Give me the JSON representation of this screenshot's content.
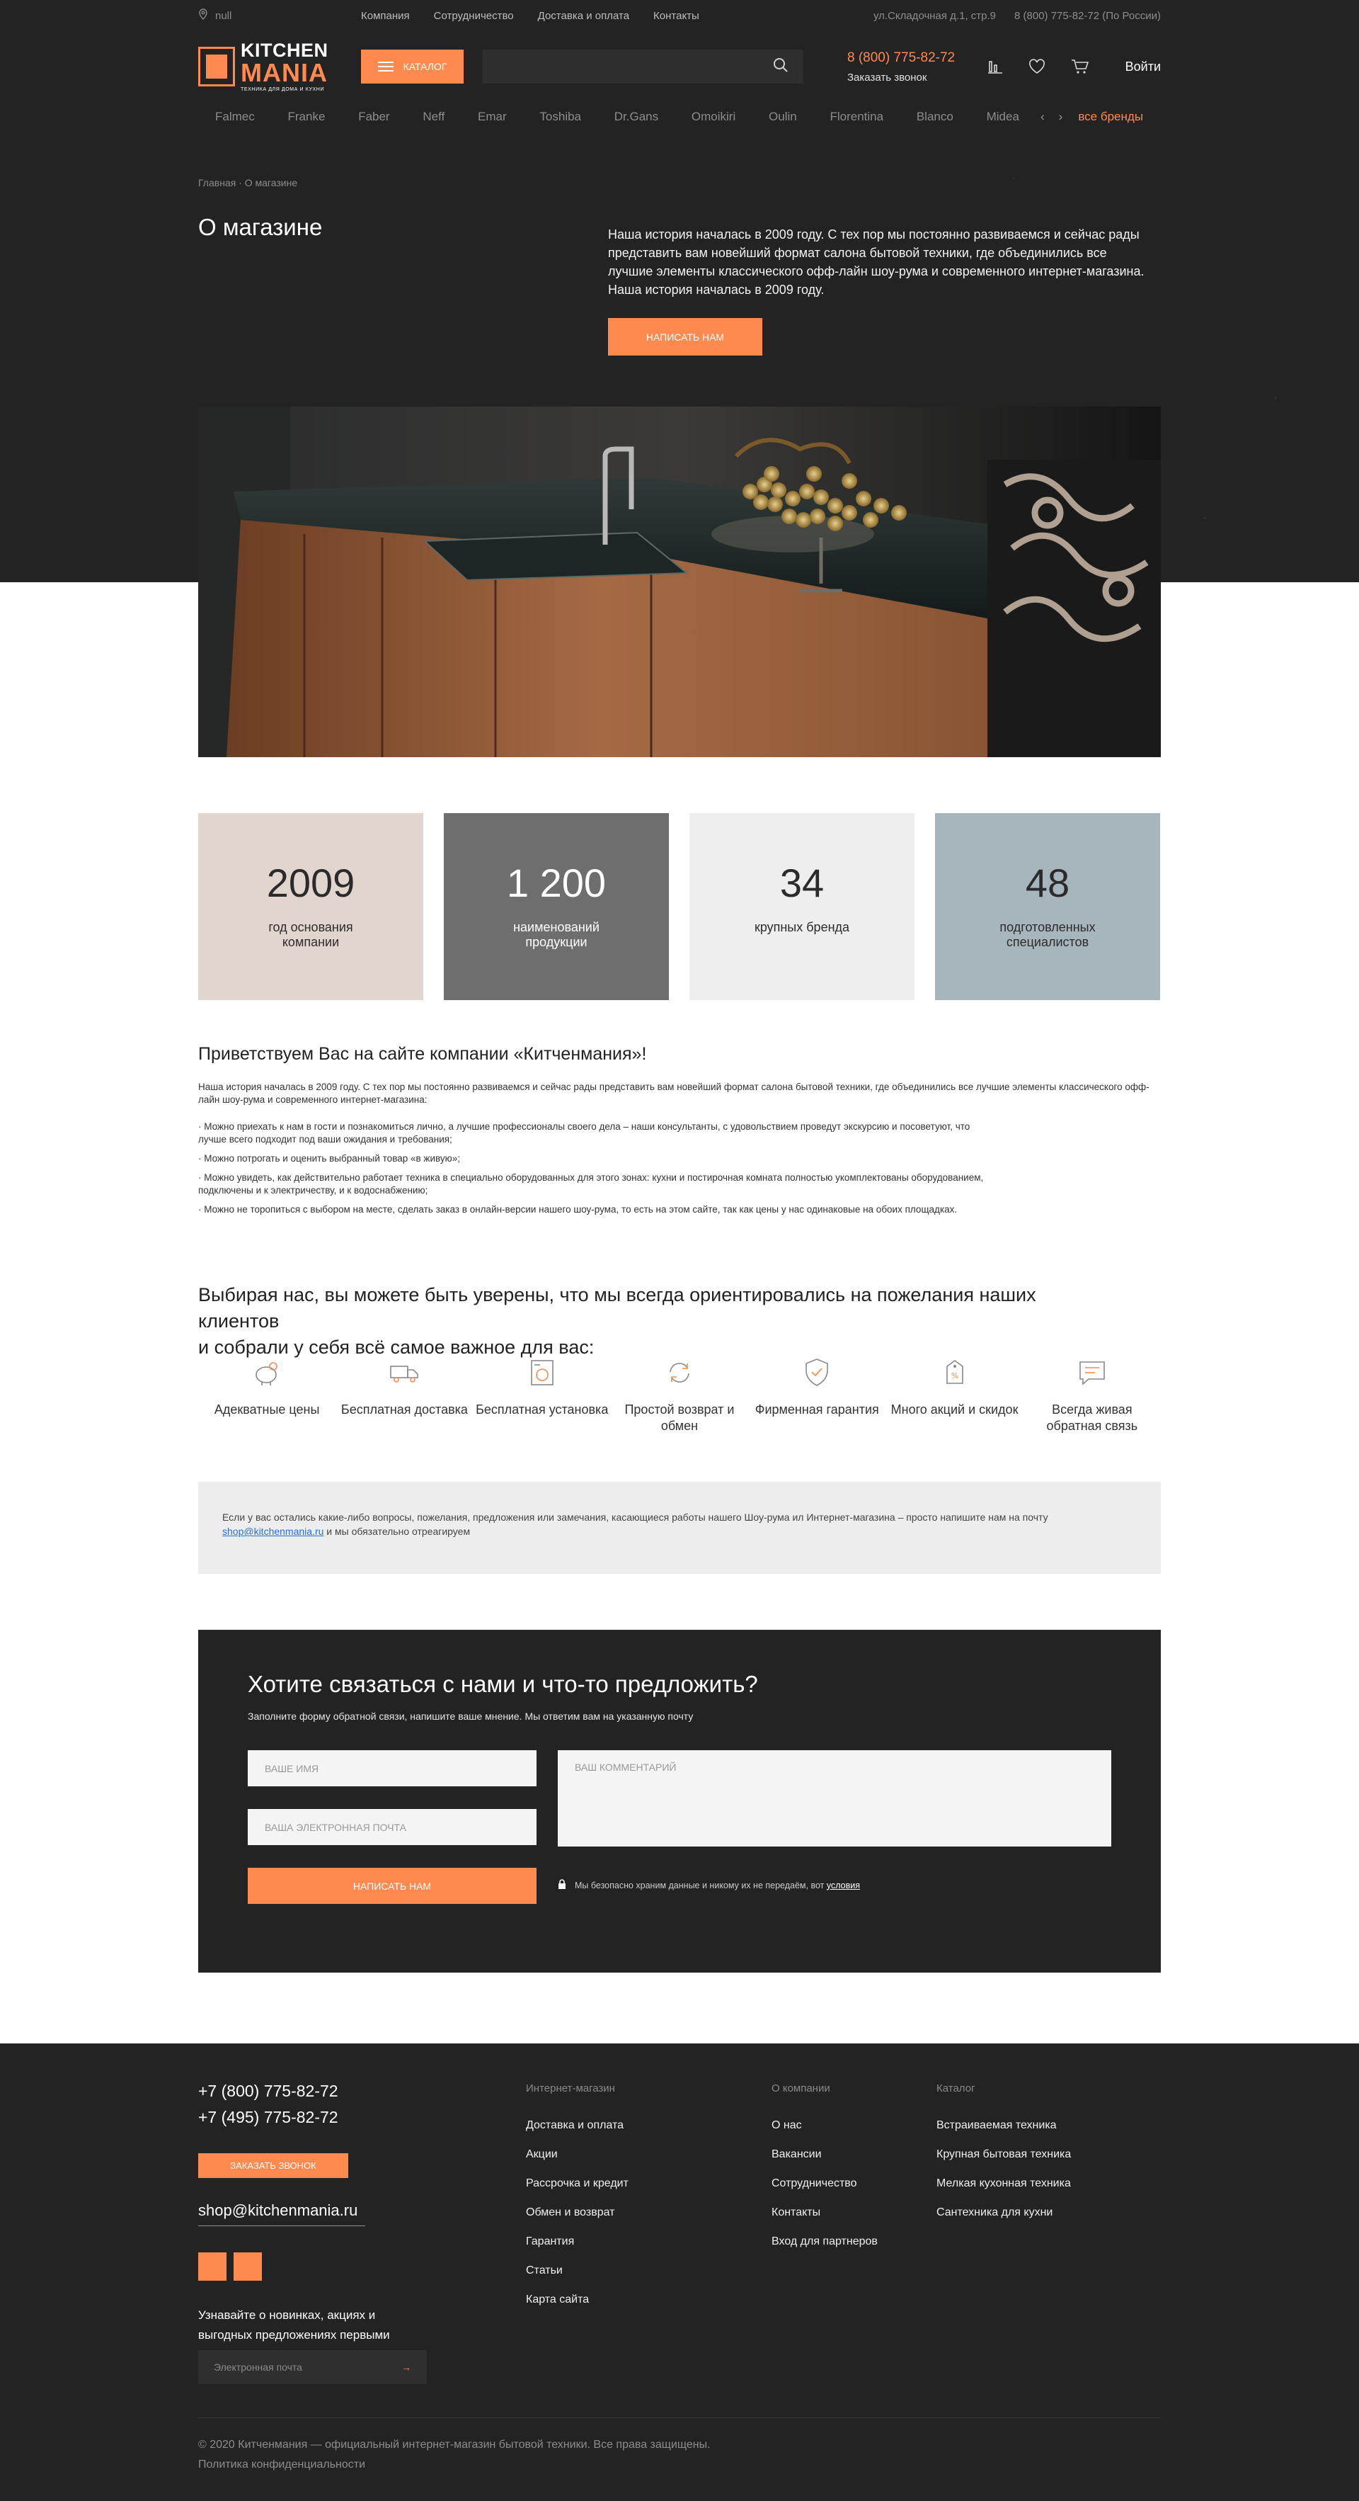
{
  "topbar": {
    "city": "null",
    "nav": [
      "Компания",
      "Сотрудничество",
      "Доставка и оплата",
      "Контакты"
    ],
    "address": "ул.Складочная д.1, стр.9",
    "phone_note": "8 (800) 775-82-72 (По России)"
  },
  "header": {
    "logo_line1": "KITCHEN",
    "logo_line2": "MANIA",
    "logo_tagline": "ТЕХНИКА ДЛЯ ДОМА И КУХНИ",
    "catalog_label": "КАТАЛОГ",
    "search_placeholder": "",
    "phone": "8 (800) 775-82-72",
    "callback": "Заказать звонок",
    "login": "Войти"
  },
  "brands": {
    "items": [
      "Falmec",
      "Franke",
      "Faber",
      "Neff",
      "Emar",
      "Toshiba",
      "Dr.Gans",
      "Omoikiri",
      "Oulin",
      "Florentina",
      "Blanco",
      "Midea"
    ],
    "prev": "‹",
    "next": "›",
    "all": "все бренды"
  },
  "hero": {
    "breadcrumbs": "Главная · О магазине",
    "title": "О магазине",
    "text": "Наша история началась в 2009 году. С тех пор мы постоянно развиваемся и сейчас рады представить вам новейший формат салона бытовой техники, где объединились все лучшие элементы классического офф-лайн шоу-рума и современного интернет-магазина. Наша история началась в 2009 году.",
    "button": "НАПИСАТЬ НАМ"
  },
  "stats": [
    {
      "value": "2009",
      "label": "год основания компании",
      "bg": "#e2d5ce",
      "color": "#2b2b2b"
    },
    {
      "value": "1 200",
      "label": "наименований продукции",
      "bg": "#6e6e6e",
      "color": "#ffffff"
    },
    {
      "value": "34",
      "label": "крупных бренда",
      "bg": "#eeeeee",
      "color": "#2b2b2b"
    },
    {
      "value": "48",
      "label": "подготовленных специалистов",
      "bg": "#a7b6bd",
      "color": "#2b2b2b"
    }
  ],
  "welcome": {
    "heading": "Приветствуем Вас на сайте компании «Китченмания»!",
    "intro": "Наша история началась в 2009 году. С тех пор мы постоянно развиваемся и сейчас рады представить вам новейший формат салона бытовой техники, где объединились все лучшие элементы классического офф-лайн шоу-рума и современного интернет-магазина:",
    "list": [
      "· Можно приехать к нам в гости и познакомиться лично, а лучшие профессионалы своего дела – наши консультанты, с удовольствием проведут экскурсию и посоветуют, что лучше всего подходит под ваши ожидания и требования;",
      "· Можно потрогать и оценить выбранный товар «в живую»;",
      "· Можно увидеть, как действительно работает техника в специально оборудованных для этого зонах: кухни и постирочная комната полностью укомплектованы оборудованием, подключены и к электричеству, и к водоснабжению;",
      "· Можно не торопиться с выбором на месте, сделать заказ в онлайн-версии нашего шоу-рума, то есть на этом сайте, так как цены у нас одинаковые на обоих площадках."
    ]
  },
  "choose": {
    "heading_line1": "Выбирая нас, вы можете быть уверены, что мы всегда ориентировались на пожелания наших клиентов",
    "heading_line2": "и собрали у себя всё самое важное для вас:",
    "features": [
      {
        "label": "Адекватные цены",
        "icon": "piggy-bank-icon"
      },
      {
        "label": "Бесплатная доставка",
        "icon": "delivery-truck-icon"
      },
      {
        "label": "Бесплатная установка",
        "icon": "installation-icon"
      },
      {
        "label": "Простой возврат и обмен",
        "icon": "return-arrows-icon"
      },
      {
        "label": "Фирменная гарантия",
        "icon": "warranty-shield-icon"
      },
      {
        "label": "Много акций и скидок",
        "icon": "discount-tag-icon"
      },
      {
        "label": "Всегда живая обратная связь",
        "icon": "chat-bubble-icon"
      }
    ]
  },
  "info": {
    "text_before": "Если у вас остались какие-либо вопросы, пожелания, предложения или замечания, касающиеся работы нашего Шоу-рума ил Интернет-магазина – просто напишите нам на почту",
    "email": "shop@kitchenmania.ru",
    "text_after": "и мы обязательно отреагируем"
  },
  "contact_form": {
    "title": "Хотите связаться с нами и что-то предложить?",
    "subtitle": "Заполните форму обратной связи, напишите ваше мнение. Мы ответим вам на указанную почту",
    "name_placeholder": "ВАШЕ ИМЯ",
    "email_placeholder": "ВАША ЭЛЕКТРОННАЯ ПОЧТА",
    "comment_placeholder": "ВАШ КОММЕНТАРИЙ",
    "submit": "НАПИСАТЬ НАМ",
    "privacy_text": "Мы безопасно храним данные и никому их не передаём, вот",
    "privacy_link": "условия"
  },
  "footer": {
    "phone1": "+7 (800) 775-82-72",
    "phone2": "+7 (495) 775-82-72",
    "callback": "ЗАКАЗАТЬ ЗВОНОК",
    "email": "shop@kitchenmania.ru",
    "newsletter_text": "Узнавайте о новинках, акциях и выгодных предложениях первыми",
    "newsletter_placeholder": "Электронная почта",
    "newsletter_arrow": "→",
    "columns": [
      {
        "heading": "Интернет-магазин",
        "items": [
          "Доставка и оплата",
          "Акции",
          "Рассрочка и кредит",
          "Обмен и возврат",
          "Гарантия",
          "Статьи",
          "Карта сайта"
        ]
      },
      {
        "heading": "О компании",
        "items": [
          "О нас",
          "Вакансии",
          "Сотрудничество",
          "Контакты",
          "Вход для партнеров"
        ]
      },
      {
        "heading": "Каталог",
        "items": [
          "Встраиваемая техника",
          "Крупная бытовая техника",
          "Мелкая кухонная техника",
          "Сантехника для кухни"
        ]
      }
    ],
    "copyright": "© 2020 Китченмания — официальный интернет-магазин бытовой техники. Все права защищены.",
    "policy": "Политика конфиденциальности"
  },
  "colors": {
    "accent": "#ff8a50",
    "dark": "#232323"
  }
}
